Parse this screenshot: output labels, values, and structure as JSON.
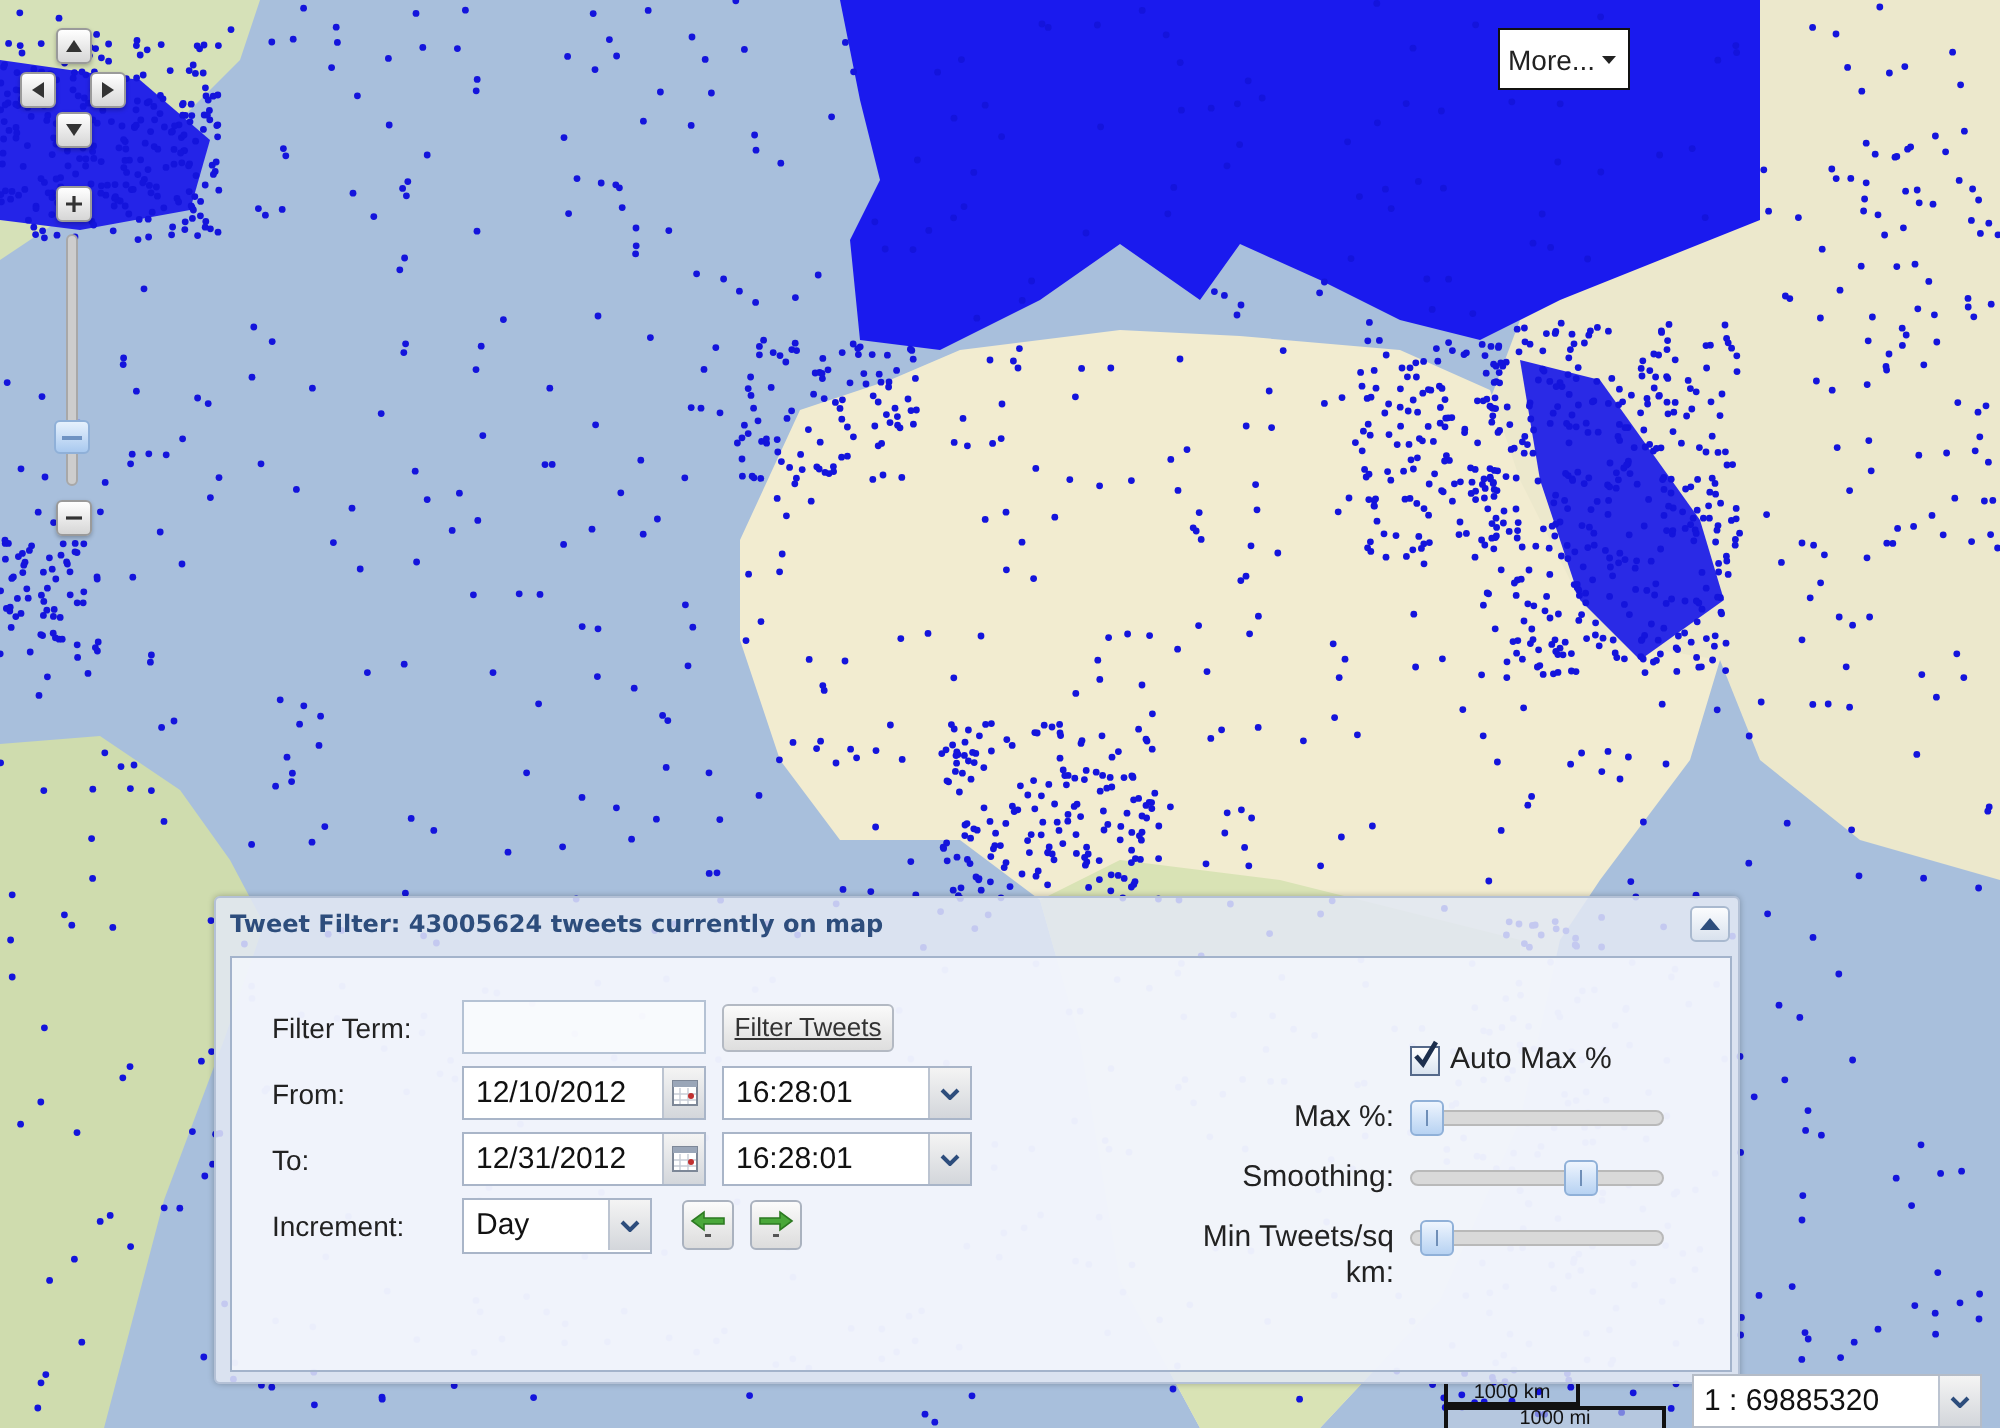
{
  "map_controls": {
    "zoom_slider": {
      "level": 0.15
    }
  },
  "more_button": {
    "label": "More..."
  },
  "filter_panel": {
    "title": "Tweet Filter: 43005624 tweets currently on map",
    "expanded": true,
    "filter_term": {
      "label": "Filter Term:"
    },
    "filter_button": {
      "label": "Filter Tweets"
    },
    "date_rows": [
      {
        "label": "From:",
        "date": "12/10/2012",
        "time": "16:28:01"
      },
      {
        "label": "To:",
        "date": "12/31/2012",
        "time": "16:28:01"
      }
    ],
    "increment": {
      "label": "Increment:",
      "value": "Day"
    },
    "auto_max": {
      "label": "Auto Max %",
      "checked": true
    },
    "sliders": [
      {
        "label": "Max %:",
        "level": 0
      },
      {
        "label": "Smoothing:",
        "level": 0.7
      },
      {
        "label": "Min Tweets/sq km:",
        "level": 0.045
      }
    ]
  },
  "scale_bar": {
    "metric": "1000 km",
    "imperial": "1000 mi"
  },
  "scale_select": {
    "value": "1 : 69885320"
  }
}
